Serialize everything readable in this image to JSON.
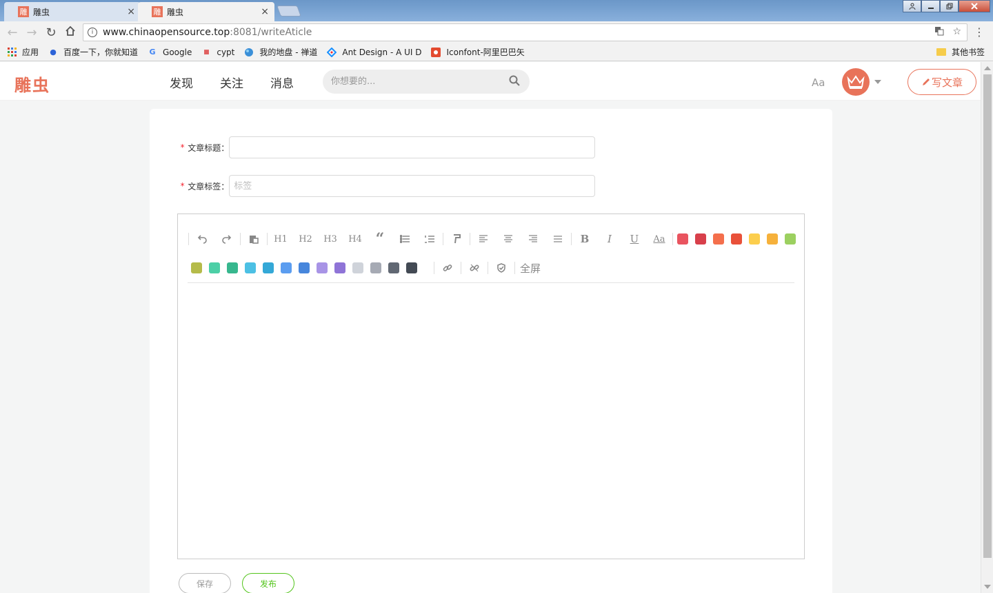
{
  "browser": {
    "tabs": [
      {
        "favicon": "雕",
        "title": "雕虫",
        "close": "×",
        "active": false
      },
      {
        "favicon": "雕",
        "title": "雕虫",
        "close": "×",
        "active": true
      }
    ],
    "address": {
      "host": "www.chinaopensource.top",
      "path": ":8081/writeAticle"
    },
    "bookmarks": [
      {
        "icon": "apps-grid-icon",
        "label": "应用"
      },
      {
        "icon": "baidu-paw-icon",
        "label": "百度一下，你就知道"
      },
      {
        "icon": "google-g-icon",
        "label": "Google"
      },
      {
        "icon": "doc-icon",
        "label": "cypt"
      },
      {
        "icon": "globe-icon",
        "label": "我的地盘 - 禅道"
      },
      {
        "icon": "ant-design-icon",
        "label": "Ant Design - A UI D"
      },
      {
        "icon": "iconfont-icon",
        "label": "Iconfont-阿里巴巴矢"
      }
    ],
    "bookmark_folder": "其他书签"
  },
  "header": {
    "logo": "雕虫",
    "nav": [
      "发现",
      "关注",
      "消息"
    ],
    "search_placeholder": "你想要的...",
    "font_toggle": "Aa",
    "write_button": "写文章",
    "accent_color": "#e8735a"
  },
  "form": {
    "title_label": "文章标题",
    "title_value": "",
    "tags_label": "文章标签",
    "tags_placeholder": "标签",
    "required_mark": "*",
    "colon": "："
  },
  "editor": {
    "headings": [
      "H1",
      "H2",
      "H3",
      "H4"
    ],
    "bold": "B",
    "italic": "I",
    "underline": "U",
    "font_size": "Aa",
    "fullscreen": "全屏",
    "colors_row1": [
      "#e9545f",
      "#d8404b",
      "#f46f4c",
      "#e9513a",
      "#fcce4d",
      "#f6b13b",
      "#9cd060"
    ],
    "colors_row2": [
      "#b5bb4a",
      "#4ccfa6",
      "#37b78e",
      "#4cc0e4",
      "#34a8d7",
      "#5b9df0",
      "#4786dc",
      "#a894e6",
      "#8f74d7",
      "#cfd3da",
      "#a6aab4",
      "#616873",
      "#434a54"
    ]
  },
  "actions": {
    "save": "保存",
    "publish": "发布"
  }
}
